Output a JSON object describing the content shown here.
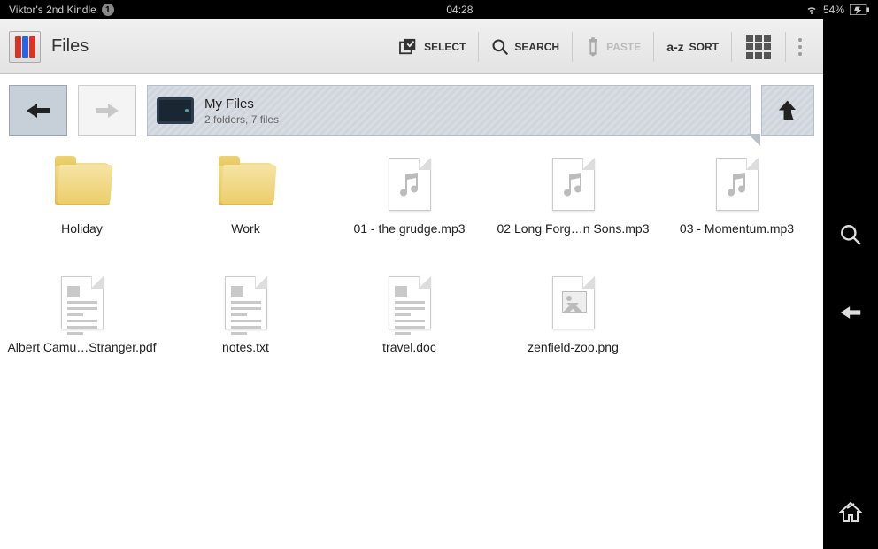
{
  "statusbar": {
    "device": "Viktor's 2nd Kindle",
    "notif_count": "1",
    "time": "04:28",
    "battery": "54%"
  },
  "toolbar": {
    "app_title": "Files",
    "select_label": "SELECT",
    "search_label": "SEARCH",
    "paste_label": "PASTE",
    "sort_label": "SORT"
  },
  "path": {
    "title": "My Files",
    "subtitle": "2 folders, 7 files"
  },
  "items": [
    {
      "name": "Holiday",
      "type": "folder"
    },
    {
      "name": "Work",
      "type": "folder"
    },
    {
      "name": "01 - the grudge.mp3",
      "type": "audio"
    },
    {
      "name": "02 Long Forg…n Sons.mp3",
      "type": "audio"
    },
    {
      "name": "03 - Momentum.mp3",
      "type": "audio"
    },
    {
      "name": "Albert Camu…Stranger.pdf",
      "type": "document"
    },
    {
      "name": "notes.txt",
      "type": "document"
    },
    {
      "name": "travel.doc",
      "type": "document"
    },
    {
      "name": "zenfield-zoo.png",
      "type": "image"
    }
  ]
}
